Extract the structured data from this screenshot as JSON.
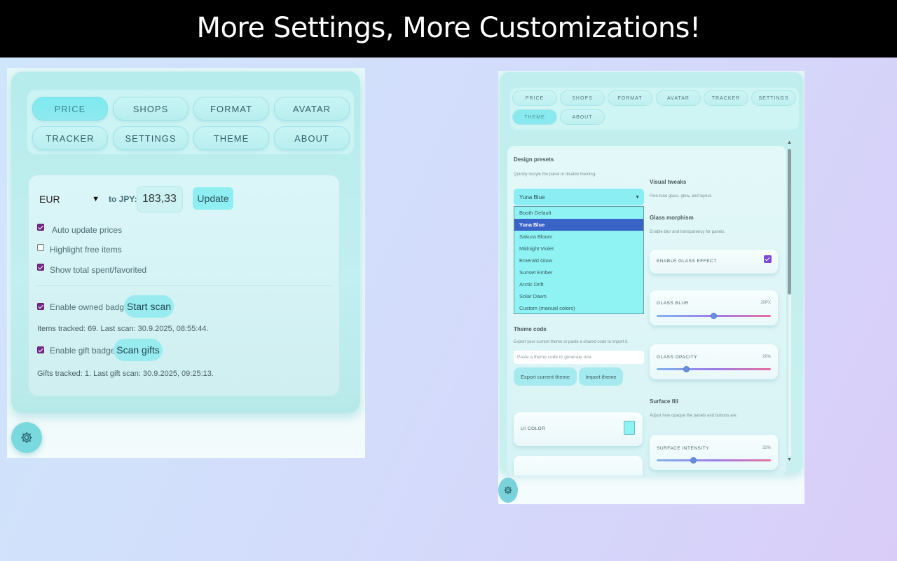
{
  "banner": {
    "title": "More Settings, More Customizations!"
  },
  "left": {
    "tabs": [
      {
        "label": "PRICE"
      },
      {
        "label": "SHOPS"
      },
      {
        "label": "FORMAT"
      },
      {
        "label": "AVATAR"
      },
      {
        "label": "TRACKER"
      },
      {
        "label": "SETTINGS"
      },
      {
        "label": "THEME"
      },
      {
        "label": "ABOUT"
      }
    ],
    "currency": {
      "selected": "EUR",
      "to_label": "to JPY:",
      "rate": "183,33",
      "update_label": "Update"
    },
    "options": {
      "auto_update": "Auto update prices",
      "highlight_free": "Highlight free items",
      "show_total": "Show total spent/favorited"
    },
    "owned": {
      "label": "Enable owned badge",
      "button": "Start scan",
      "status": "Items tracked: 69. Last scan: 30.9.2025, 08:55:44."
    },
    "gift": {
      "label": "Enable gift badge",
      "button": "Scan gifts",
      "status": "Gifts tracked: 1. Last gift scan: 30.9.2025, 09:25:13."
    }
  },
  "right": {
    "tabs": [
      {
        "label": "PRICE"
      },
      {
        "label": "SHOPS"
      },
      {
        "label": "FORMAT"
      },
      {
        "label": "AVATAR"
      },
      {
        "label": "TRACKER"
      },
      {
        "label": "SETTINGS"
      },
      {
        "label": "THEME"
      },
      {
        "label": "ABOUT"
      }
    ],
    "presets": {
      "title": "Design presets",
      "subtitle": "Quickly restyle the panel or disable theming.",
      "selected": "Yuna Blue",
      "options": [
        "Booth Default",
        "Yuna Blue",
        "Sakura Bloom",
        "Midnight Violet",
        "Emerald Glow",
        "Sunset Ember",
        "Arctic Drift",
        "Solar Dawn",
        "Custom (manual colors)"
      ]
    },
    "theme_code": {
      "title": "Theme code",
      "subtitle": "Export your current theme or paste a shared code to import it.",
      "placeholder": "Paste a theme code or generate one.",
      "export_label": "Export current theme",
      "import_label": "Import theme"
    },
    "ui_color": {
      "label": "UI COLOR",
      "value": "#8ff3f4"
    },
    "visual": {
      "title": "Visual tweaks",
      "subtitle": "Fine-tune glass, glow, and layout."
    },
    "glass": {
      "title": "Glass morphism",
      "subtitle": "Enable blur and transparency for panels.",
      "enable_label": "ENABLE GLASS EFFECT",
      "blur_label": "GLASS BLUR",
      "blur_value": "20PX",
      "blur_level": 0.5,
      "opacity_label": "GLASS OPACITY",
      "opacity_value": "26%",
      "opacity_level": 0.26
    },
    "surface": {
      "title": "Surface fill",
      "subtitle": "Adjust how opaque the panels and buttons are.",
      "intensity_label": "SURFACE INTENSITY",
      "intensity_value": "32%",
      "intensity_level": 0.32
    }
  }
}
